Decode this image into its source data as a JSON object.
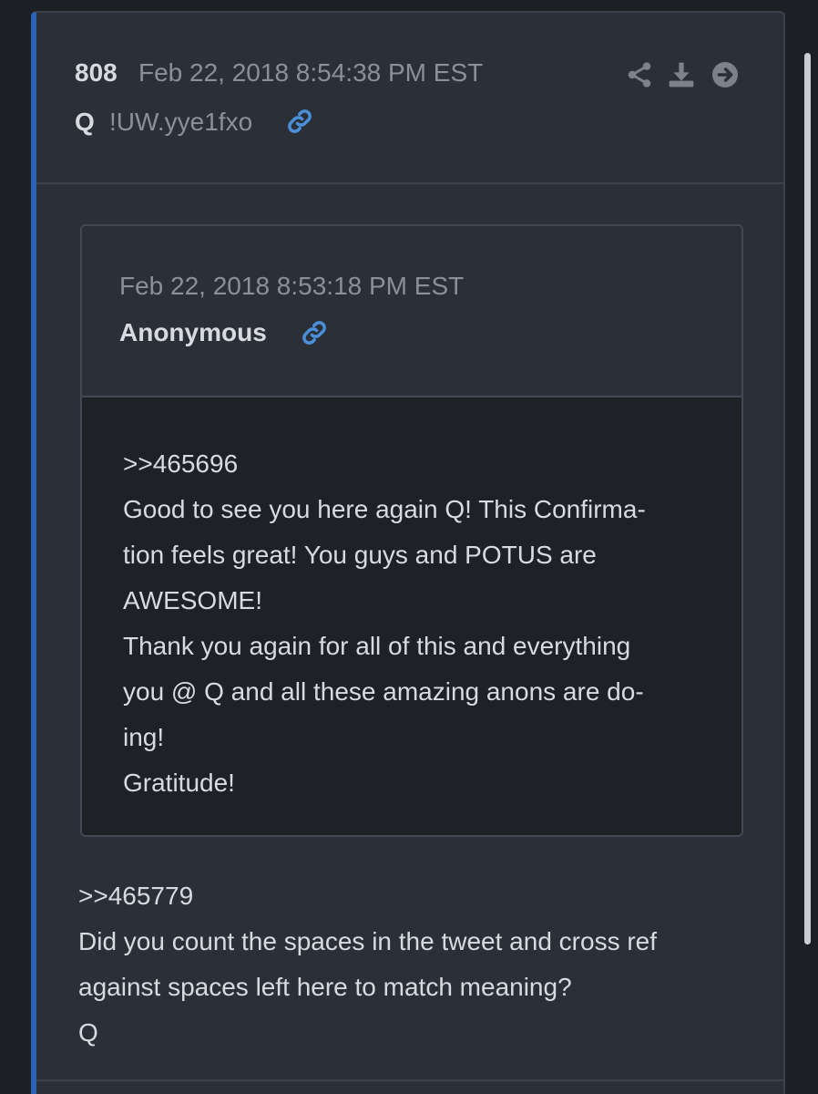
{
  "post": {
    "number": "808",
    "date": "Feb 22, 2018 8:54:38 PM EST",
    "author": "Q",
    "tripcode": "!UW.yye1fxo",
    "lines": [
      ">>465779",
      "Did you count the spaces in the tweet and cross ref",
      "against spaces left here to match meaning?",
      "Q"
    ]
  },
  "quote": {
    "date": "Feb 22, 2018 8:53:18 PM EST",
    "author": "Anonymous",
    "lines": [
      ">>465696",
      "Good to see you here again Q! This Confirma-",
      "tion feels great! You guys and POTUS are",
      "AWESOME!",
      "Thank you again for all of this and everything",
      "you @ Q and all these amazing anons are do-",
      "ing!",
      "Gratitude!"
    ]
  },
  "icons": {
    "share": "share-icon",
    "download": "download-icon",
    "open": "arrow-right-circle-icon",
    "link": "link-icon"
  },
  "colors": {
    "accent": "#2d63b4",
    "link": "#4a90d9",
    "text": "#d7dbe0",
    "muted": "#8a9099"
  }
}
